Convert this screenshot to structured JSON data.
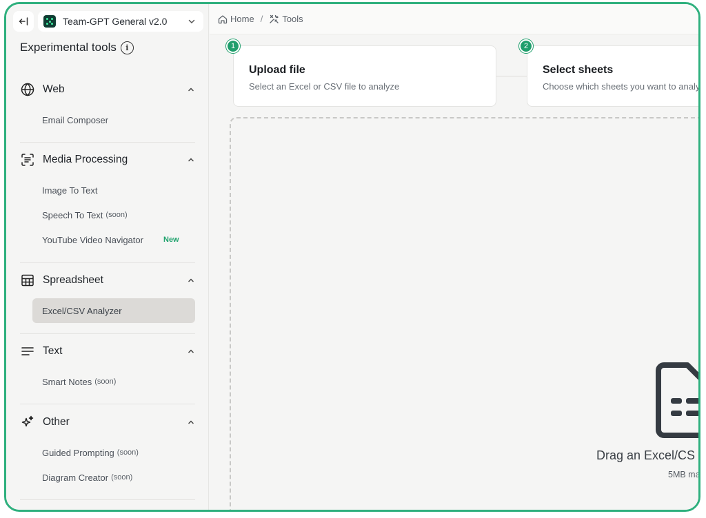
{
  "workspace": {
    "name": "Team-GPT General v2.0"
  },
  "sidebar": {
    "title": "Experimental tools",
    "sections": [
      {
        "label": "Web",
        "icon": "globe-icon",
        "items": [
          {
            "label": "Email Composer"
          }
        ]
      },
      {
        "label": "Media Processing",
        "icon": "scan-text-icon",
        "items": [
          {
            "label": "Image To Text"
          },
          {
            "label": "Speech To Text",
            "soon": "(soon)"
          },
          {
            "label": "YouTube Video Navigator",
            "badge": "New"
          }
        ]
      },
      {
        "label": "Spreadsheet",
        "icon": "table-icon",
        "items": [
          {
            "label": "Excel/CSV Analyzer",
            "active": true
          }
        ]
      },
      {
        "label": "Text",
        "icon": "lines-icon",
        "items": [
          {
            "label": "Smart Notes",
            "soon": "(soon)"
          }
        ]
      },
      {
        "label": "Other",
        "icon": "sparkles-icon",
        "items": [
          {
            "label": "Guided Prompting",
            "soon": "(soon)"
          },
          {
            "label": "Diagram Creator",
            "soon": "(soon)"
          }
        ]
      }
    ]
  },
  "breadcrumb": {
    "home": "Home",
    "separator": "/",
    "current": "Tools"
  },
  "steps": [
    {
      "number": "1",
      "title": "Upload file",
      "description": "Select an Excel or CSV file to analyze"
    },
    {
      "number": "2",
      "title": "Select sheets",
      "description": "Choose which sheets you want to analy"
    }
  ],
  "dropzone": {
    "text": "Drag an Excel/CS",
    "limit": "5MB ma"
  },
  "colors": {
    "accent": "#1f9e6c",
    "frame": "#2fb07e",
    "active_item": "#dcdad7"
  }
}
